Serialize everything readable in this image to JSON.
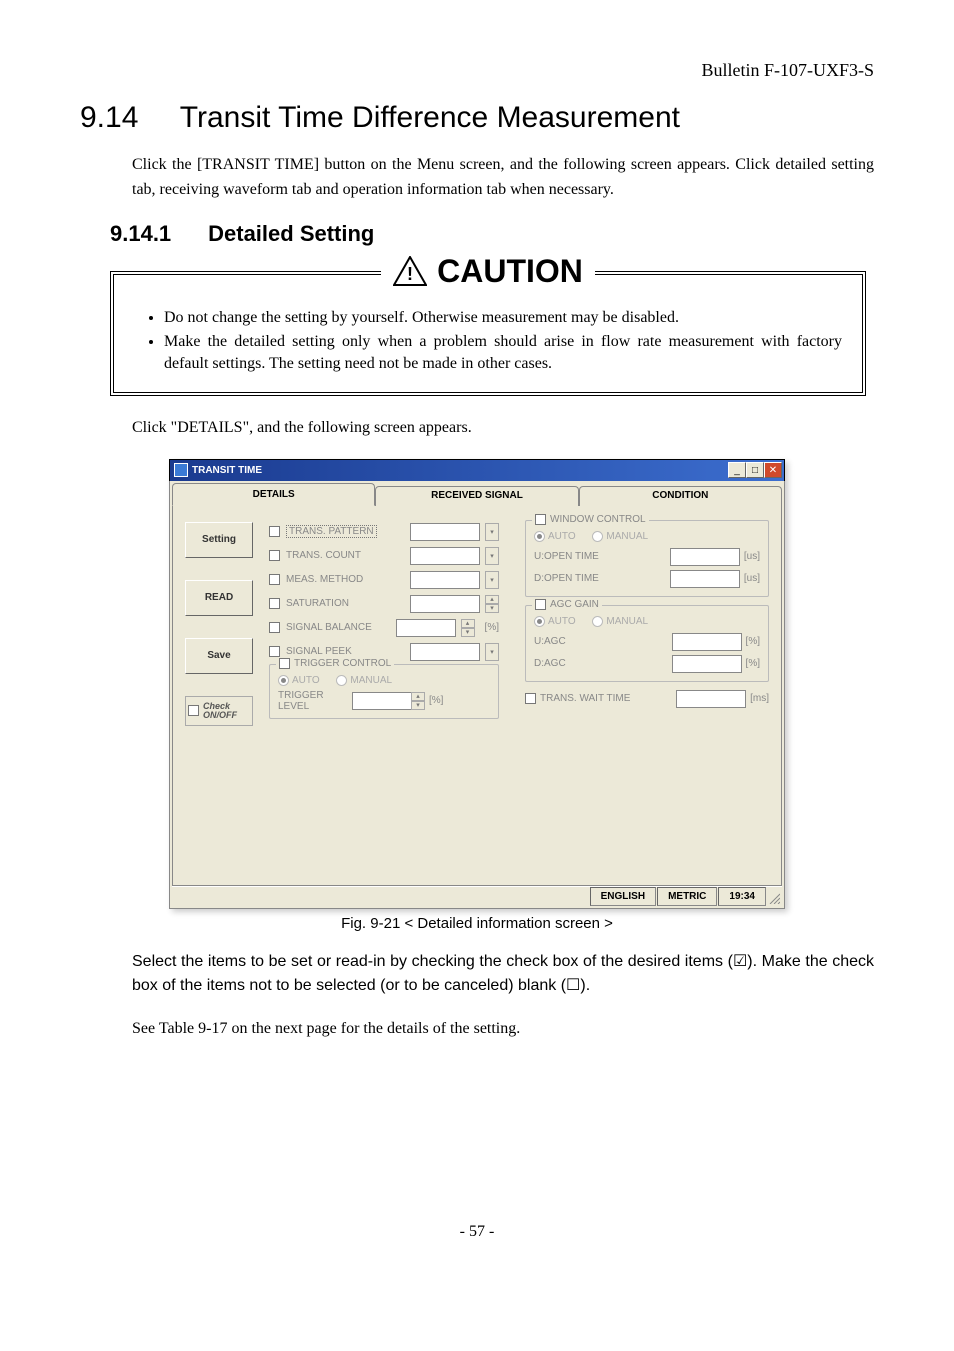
{
  "header": {
    "bulletin": "Bulletin F-107-UXF3-S"
  },
  "section": {
    "num": "9.14",
    "title": "Transit Time Difference Measurement",
    "intro": "Click the [TRANSIT TIME] button on the Menu screen, and the following screen appears.    Click detailed setting tab, receiving waveform tab and operation information tab when necessary.",
    "subnum": "9.14.1",
    "subtitle": "Detailed Setting"
  },
  "caution": {
    "heading": "CAUTION",
    "bullets": [
      "Do not change the setting by yourself.    Otherwise measurement may be disabled.",
      "Make the detailed setting only when a problem should arise in flow rate measurement with factory default settings.    The setting need not be made in other cases."
    ]
  },
  "lead": "Click \"DETAILS\", and the following screen appears.",
  "screenshot": {
    "title": "TRANSIT TIME",
    "tabs": [
      "DETAILS",
      "RECEIVED SIGNAL",
      "CONDITION"
    ],
    "side_buttons": [
      "Setting",
      "READ",
      "Save"
    ],
    "check_toggle": "Check ON/OFF",
    "left": {
      "trans_pattern": "TRANS. PATTERN",
      "trans_count": "TRANS. COUNT",
      "meas_method": "MEAS. METHOD",
      "saturation": "SATURATION",
      "signal_balance": "SIGNAL BALANCE",
      "signal_balance_unit": "[%]",
      "signal_peek": "SIGNAL PEEK",
      "trigger_control": "TRIGGER CONTROL",
      "auto": "AUTO",
      "manual": "MANUAL",
      "trigger_level": "TRIGGER LEVEL",
      "trigger_unit": "[%]"
    },
    "right": {
      "window_control": "WINDOW CONTROL",
      "auto": "AUTO",
      "manual": "MANUAL",
      "u_open_time": "U:OPEN TIME",
      "d_open_time": "D:OPEN TIME",
      "open_unit": "[us]",
      "agc_gain": "AGC GAIN",
      "u_agc": "U:AGC",
      "d_agc": "D:AGC",
      "agc_unit": "[%]",
      "trans_wait": "TRANS. WAIT TIME",
      "wait_unit": "[ms]"
    },
    "status": {
      "lang": "ENGLISH",
      "system": "METRIC",
      "time": "19:34"
    }
  },
  "figure_caption": "Fig. 9-21 < Detailed information screen >",
  "outro1": "Select the items to be set or read-in by checking the check box of the desired items (☑). Make the check box of the items not to be selected (or to be canceled) blank (☐).",
  "outro2": "See Table 9-17 on the next page for the details of the setting.",
  "footer": "- 57 -"
}
